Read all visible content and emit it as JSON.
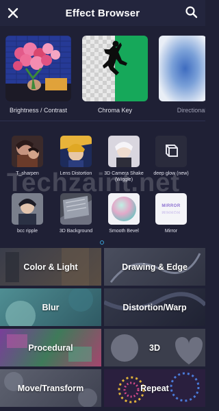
{
  "header": {
    "title": "Effect Browser",
    "close_icon": "close-icon",
    "search_icon": "search-icon"
  },
  "featured": [
    {
      "label": "Brightness / Contrast"
    },
    {
      "label": "Chroma Key"
    },
    {
      "label": "Directional"
    }
  ],
  "effects": [
    {
      "label": "T_sharpen"
    },
    {
      "label": "Lens Distortion"
    },
    {
      "label": "3D Camera Shake (Wiggle)"
    },
    {
      "label": "deep glow (new)"
    },
    {
      "label": "bcc ripple"
    },
    {
      "label": "3D Background"
    },
    {
      "label": "Smooth Bevel"
    },
    {
      "label": "Mirror"
    }
  ],
  "mirror_thumb_text": "MIRROR",
  "categories": [
    {
      "label": "Color & Light"
    },
    {
      "label": "Drawing & Edge"
    },
    {
      "label": "Blur"
    },
    {
      "label": "Distortion/Warp"
    },
    {
      "label": "Procedural"
    },
    {
      "label": "3D"
    },
    {
      "label": "Move/Transform"
    },
    {
      "label": "Repeat"
    }
  ],
  "watermark": "Techzaint.net",
  "colors": {
    "background": "#1f2035",
    "header": "#23253d",
    "accent": "#3aa3d8",
    "chroma_green": "#16a85a"
  }
}
